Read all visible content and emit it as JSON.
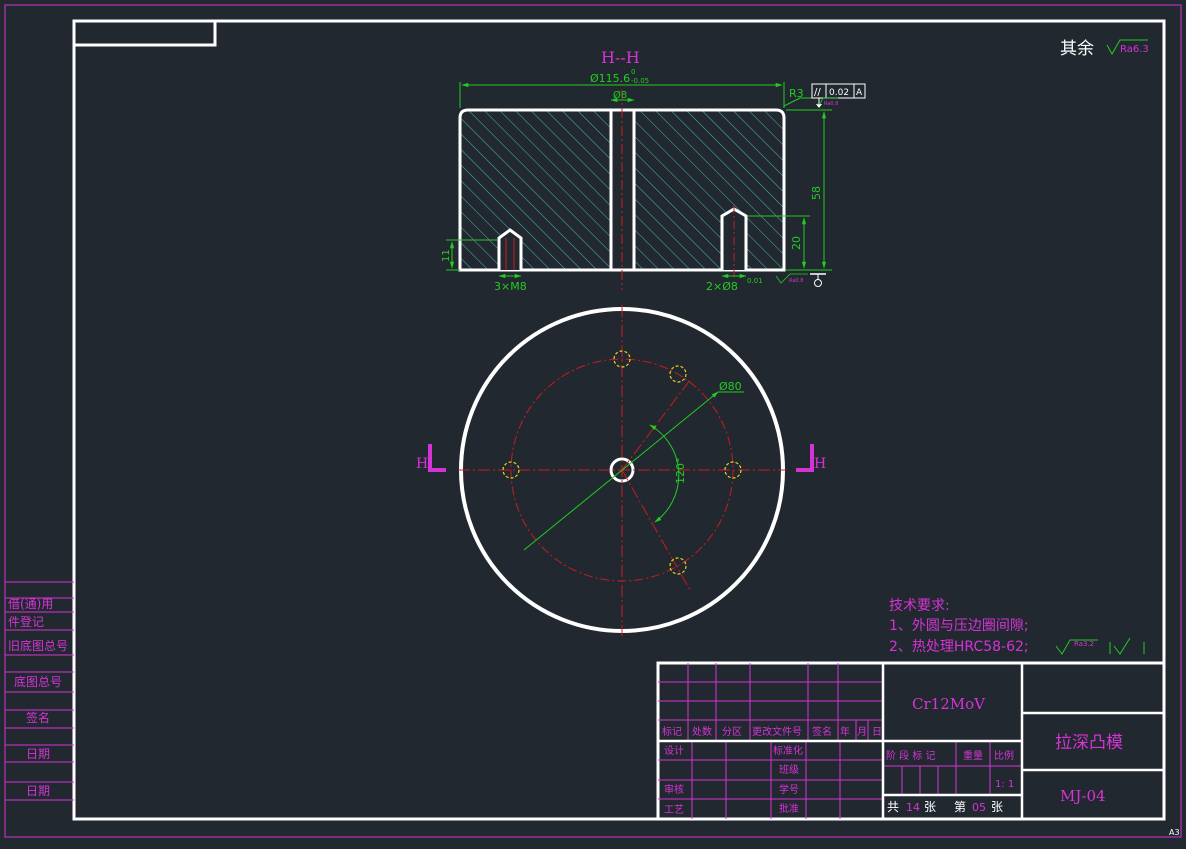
{
  "colors": {
    "background": "#212830",
    "frame": "#ffffff",
    "magenta": "#d633d6",
    "dimension_green": "#22cc22",
    "center_red": "#cc1b1b",
    "hatch_cyan": "#4fb8b8",
    "hole_yellow": "#e6d21e"
  },
  "section": {
    "title": "H--H",
    "dia_main": "Ø115.6",
    "tol_upper": "0",
    "tol_lower": "-0.05",
    "dia_center": "Ø8",
    "radius": "R3",
    "parallel_symbol": "//",
    "parallel_value": "0.02",
    "datum": "A",
    "rough_small_1": "Ra0.8",
    "rough_small_2": "Ra0.8",
    "dim_height": "58",
    "dim_pin_depth": "20",
    "dim_tap_depth": "11",
    "label_taps": "3×M8",
    "label_pins": "2×Ø8",
    "pin_tol": "0.01"
  },
  "plan": {
    "dia_bolt_circle": "Ø80",
    "angle": "120°",
    "section_mark_left": "H",
    "section_mark_right": "H"
  },
  "rest_roughness": {
    "label": "其余",
    "value": "Ra6.3"
  },
  "tech": {
    "title": "技术要求:",
    "line1": "1、外圆与压边圈间隙;",
    "line2": "2、热处理HRC58-62;",
    "line2_rough": "Ra3.2"
  },
  "side_table": [
    "借(通)用",
    "件登记",
    "旧底图总号",
    "底图总号",
    "签名",
    "日期",
    "日期"
  ],
  "title_block": {
    "material": "Cr12MoV",
    "part_name": "拉深凸模",
    "drawing_no": "MJ-04",
    "rev_headers": [
      "标记",
      "处数",
      "分区",
      "更改文件号",
      "签名",
      "年",
      "月",
      "日"
    ],
    "row_labels": [
      "设计",
      "审核",
      "工艺"
    ],
    "mid_labels": [
      "标准化",
      "班级",
      "学号",
      "批准"
    ],
    "stage_headers": [
      "阶 段 标 记",
      "重量",
      "比例"
    ],
    "scale": "1: 1",
    "sheet_total_prefix": "共",
    "sheet_total": "14",
    "sheet_unit": "张",
    "sheet_no_prefix": "第",
    "sheet_no": "05",
    "sheet_no_unit": "张"
  },
  "paper_size": "A3"
}
